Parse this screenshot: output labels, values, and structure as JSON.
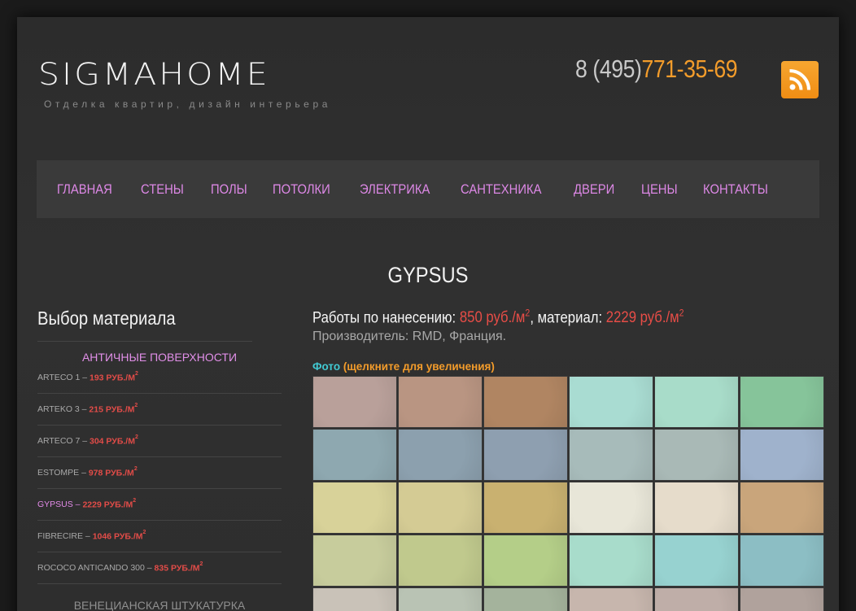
{
  "header": {
    "logo": "SIGMAHOME",
    "tagline": "Отделка квартир, дизайн интерьера",
    "phone_code": "8 (495)",
    "phone_number": "771-35-69",
    "rss_icon": "rss-icon"
  },
  "nav": [
    "ГЛАВНАЯ",
    "СТЕНЫ",
    "ПОЛЫ",
    "ПОТОЛКИ",
    "ЭЛЕКТРИКА",
    "САНТЕХНИКА",
    "ДВЕРИ",
    "ЦЕНЫ",
    "КОНТАКТЫ"
  ],
  "page_title": "GYPSUS",
  "sidebar": {
    "title": "Выбор материала",
    "category1": "АНТИЧНЫЕ ПОВЕРХНОСТИ",
    "items": [
      {
        "name": "ARTECO 1 –",
        "price": "193 РУБ./М",
        "sup": "2",
        "active": false
      },
      {
        "name": "ARTEKO 3 –",
        "price": "215 РУБ./М",
        "sup": "2",
        "active": false
      },
      {
        "name": "ARTECO 7 –",
        "price": "304 РУБ./М",
        "sup": "2",
        "active": false
      },
      {
        "name": "ESTOMPE –",
        "price": "978 РУБ./М",
        "sup": "2",
        "active": false
      },
      {
        "name": "GYPSUS –",
        "price": "2229 РУБ./М",
        "sup": "2",
        "active": true
      },
      {
        "name": "FIBRECIRE –",
        "price": "1046 РУБ./М",
        "sup": "2",
        "active": false
      },
      {
        "name": "ROCOCO ANTICANDO 300 –",
        "price": "835 РУБ./М",
        "sup": "2",
        "active": false
      }
    ],
    "category2": "ВЕНЕЦИАНСКАЯ ШТУКАТУРКА"
  },
  "content": {
    "work_label": "Работы по нанесению:",
    "work_price": "850 руб./м",
    "material_label": "материал:",
    "material_price": "2229 руб./м",
    "sup": "2",
    "maker": "Производитель: RMD, Франция.",
    "photo_label": "Фото",
    "photo_hint": "(щелкните для увеличения)",
    "swatches": [
      "#b9a09a",
      "#b99582",
      "#b08562",
      "#a9dcd2",
      "#a8dcc9",
      "#86c49a",
      "#8ea8b0",
      "#8ca0ae",
      "#8e9fb0",
      "#a7bbba",
      "#a9b9b6",
      "#9fb2cc",
      "#d8d299",
      "#d4cb94",
      "#c9b170",
      "#e8e6d8",
      "#e6dccb",
      "#c9a57b",
      "#c7cc9c",
      "#c0c98d",
      "#b4ce88",
      "#a8dccb",
      "#97d2d0",
      "#8cbec4",
      "#c9c2b8",
      "#b9c3b4",
      "#a4b39c",
      "#c7b6ad",
      "#bfaea8",
      "#b0a29c"
    ]
  }
}
